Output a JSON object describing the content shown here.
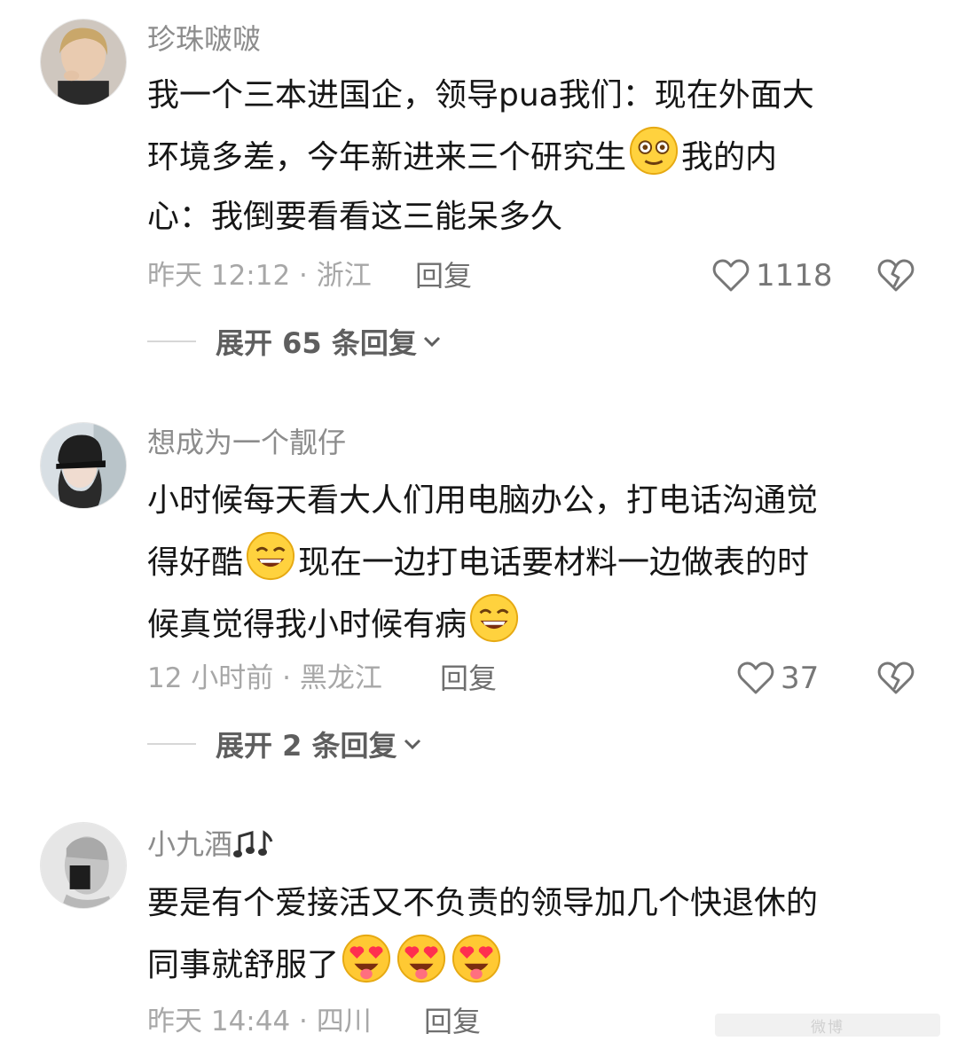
{
  "comments": [
    {
      "username": "珍珠啵啵",
      "line1": "我一个三本进国企，领导pua我们：现在外面大",
      "line2a": "环境多差，今年新进来三个研究生",
      "line2b": "我的内",
      "line3": "心：我倒要看看这三能呆多久",
      "emoji": "dazed-face-emoji",
      "meta": "昨天 12:12 · 浙江",
      "reply_label": "回复",
      "likes": "1118",
      "expand_text": "展开 65 条回复"
    },
    {
      "username": "想成为一个靓仔",
      "line1": "小时候每天看大人们用电脑办公，打电话沟通觉",
      "line2a": "得好酷",
      "line2b": "现在一边打电话要材料一边做表的时",
      "line3": "候真觉得我小时候有病",
      "emoji": "grinning-face-emoji",
      "meta": "12 小时前 · 黑龙江",
      "reply_label": "回复",
      "likes": "37",
      "expand_text": "展开 2 条回复"
    },
    {
      "username": "小九酒",
      "username_icon": "music-notes-icon",
      "line1": "要是有个爱接活又不负责的领导加几个快退休的",
      "line2": "同事就舒服了",
      "emoji": "heart-eyes-tongue-emoji",
      "meta": "昨天 14:44 · 四川",
      "reply_label": "回复"
    }
  ],
  "watermark": "微博",
  "colors": {
    "username": "#8c8c8c",
    "text": "#161616",
    "meta": "#a7a7a7",
    "icon": "#777777"
  }
}
